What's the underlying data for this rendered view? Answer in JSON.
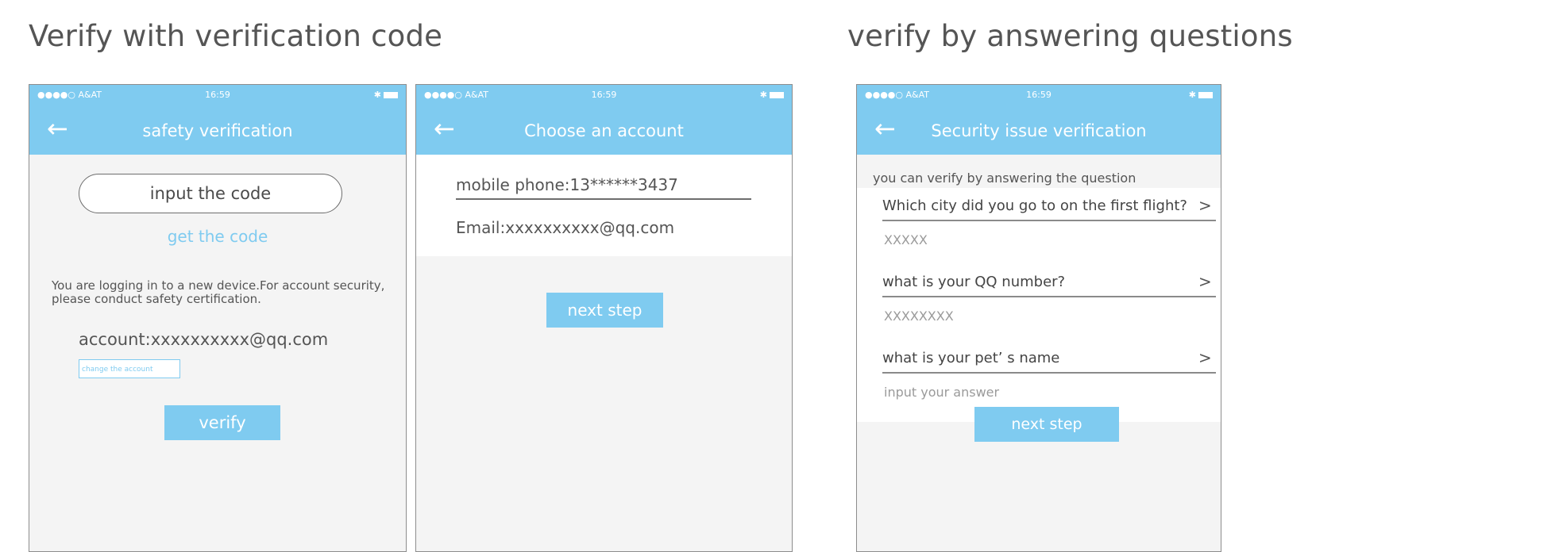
{
  "sections": {
    "left_title": "Verify with verification code",
    "right_title": "verify by answering questions"
  },
  "status_bar": {
    "carrier": "●●●●○ A&AT",
    "time": "16:59",
    "time_alt": "16:59",
    "right": "✱"
  },
  "colors": {
    "accent": "#7fcbf0",
    "background": "#f4f4f4",
    "text": "#555555"
  },
  "screen1": {
    "title": "safety verification",
    "code_placeholder": "input the code",
    "get_code": "get the code",
    "notice": "You are logging in to a new device.For account security, please conduct safety certification.",
    "account": "account:xxxxxxxxxx@qq.com",
    "change_account": "change the account",
    "verify": "verify"
  },
  "screen2": {
    "title": "Choose an account",
    "mobile": "mobile phone:13******3437",
    "email": "Email:xxxxxxxxxx@qq.com",
    "next": "next step"
  },
  "screen3": {
    "title": "Security issue verification",
    "hint": "you can verify by answering the question",
    "questions": [
      {
        "q": "Which city did you go to on the first flight?",
        "a": "XXXXX"
      },
      {
        "q": "what is your QQ number?",
        "a": "XXXXXXXX"
      },
      {
        "q": "what is your pet’ s name",
        "a": "input your answer"
      }
    ],
    "next": "next step"
  }
}
